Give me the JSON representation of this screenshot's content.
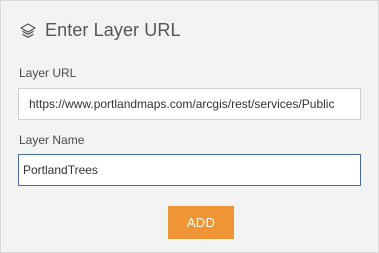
{
  "header": {
    "icon": "layers-icon",
    "title": "Enter Layer URL"
  },
  "form": {
    "url_label": "Layer URL",
    "url_value": "https://www.portlandmaps.com/arcgis/rest/services/Public",
    "name_label": "Layer Name",
    "name_value": "PortlandTrees"
  },
  "actions": {
    "add_label": "ADD"
  },
  "colors": {
    "accent": "#ef9536",
    "focus_border": "#4a6b98",
    "panel_bg": "#f3f3f3"
  }
}
